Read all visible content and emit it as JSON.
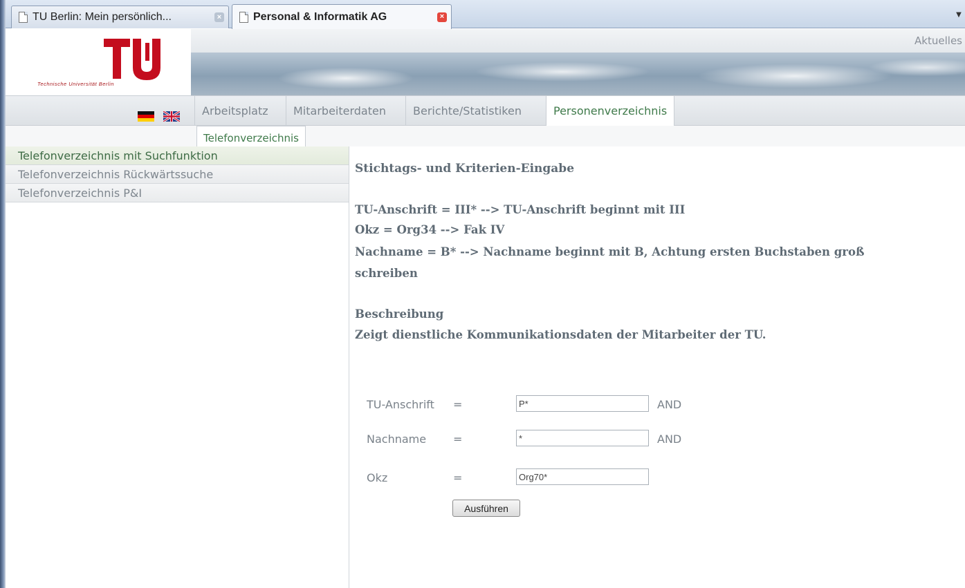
{
  "browser": {
    "tabs": [
      {
        "title": "TU Berlin: Mein persönlich...",
        "active": false
      },
      {
        "title": "Personal & Informatik AG",
        "active": true
      }
    ]
  },
  "header": {
    "logo_caption": "Technische Universität Berlin",
    "aktuelles": "Aktuelles"
  },
  "nav": {
    "items": [
      "Arbeitsplatz",
      "Mitarbeiterdaten",
      "Berichte/Statistiken",
      "Personenverzeichnis"
    ],
    "active_item": "Personenverzeichnis"
  },
  "subnav": {
    "active": "Telefonverzeichnis"
  },
  "sidebar": {
    "items": [
      {
        "label": "Telefonverzeichnis mit Suchfunktion",
        "active": true
      },
      {
        "label": "Telefonverzeichnis Rückwärtssuche",
        "active": false
      },
      {
        "label": "Telefonverzeichnis P&I",
        "active": false
      }
    ]
  },
  "main": {
    "heading": "Stichtags- und Kriterien-Eingabe",
    "criteria_lines": [
      "TU-Anschrift = III* --> TU-Anschrift beginnt mit III",
      "Okz = Org34 --> Fak IV",
      "Nachname = B* --> Nachname beginnt mit B, Achtung ersten Buchstaben groß",
      "schreiben"
    ],
    "beschreibung_title": "Beschreibung",
    "beschreibung_text": "Zeigt dienstliche Kommunikationsdaten der Mitarbeiter der TU."
  },
  "form": {
    "fields": [
      {
        "label": "TU-Anschrift",
        "eq": "=",
        "value": "P*",
        "op": "AND"
      },
      {
        "label": "Nachname",
        "eq": "=",
        "value": "*",
        "op": "AND"
      },
      {
        "label": "Okz",
        "eq": "=",
        "value": "Org70*",
        "op": ""
      }
    ],
    "submit_label": "Ausführen"
  },
  "colors": {
    "accent_green": "#3f7a4a",
    "tu_red": "#c40d1e",
    "text_grey": "#5f6b75"
  }
}
